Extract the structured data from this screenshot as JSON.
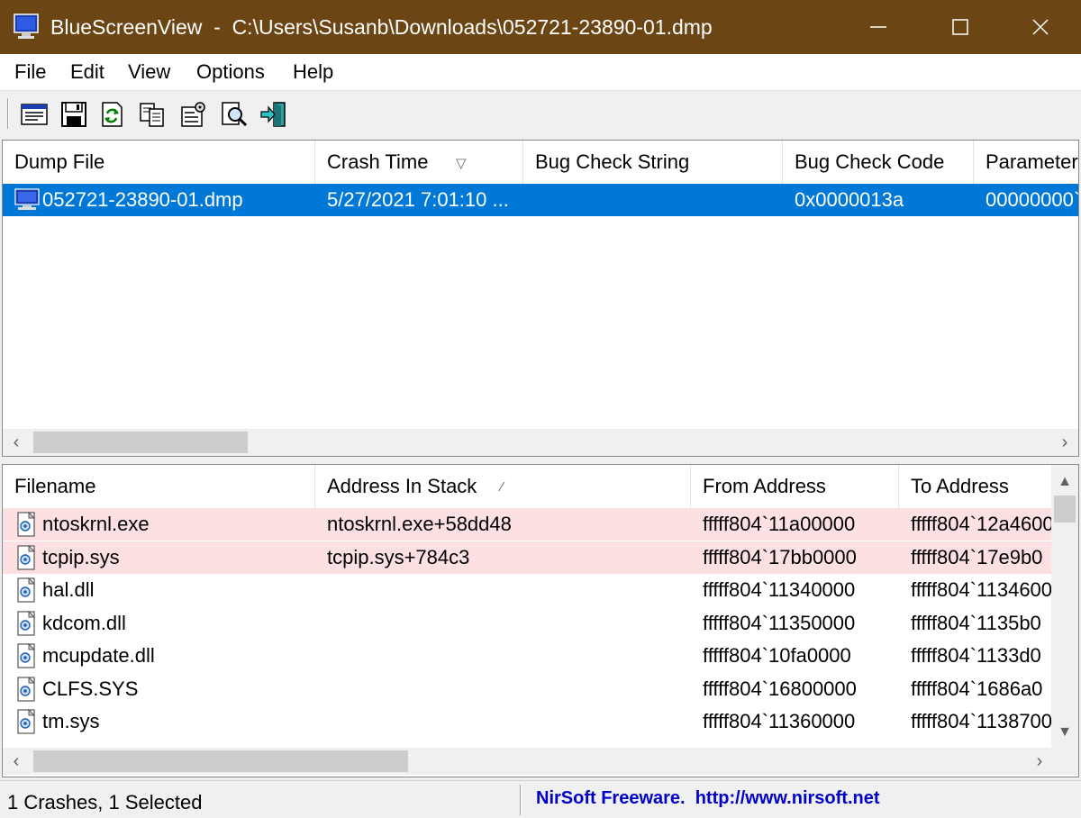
{
  "window": {
    "title": "BlueScreenView  -  C:\\Users\\Susanb\\Downloads\\052721-23890-01.dmp"
  },
  "menu": [
    "File",
    "Edit",
    "View",
    "Options",
    "Help"
  ],
  "toolbar_icons": [
    "properties-icon",
    "save-icon",
    "refresh-icon",
    "copy-icon",
    "advanced-options-icon",
    "find-icon",
    "exit-icon"
  ],
  "crash_list": {
    "columns": [
      "Dump File",
      "Crash Time",
      "Bug Check String",
      "Bug Check Code",
      "Parameter"
    ],
    "sorted_column": "Crash Time",
    "rows": [
      {
        "dump_file": "052721-23890-01.dmp",
        "crash_time": "5/27/2021 7:01:10 ...",
        "bug_check_string": "",
        "bug_check_code": "0x0000013a",
        "parameter": "00000000`0",
        "selected": true
      }
    ]
  },
  "driver_list": {
    "columns": [
      "Filename",
      "Address In Stack",
      "From Address",
      "To Address"
    ],
    "sorted_column": "Address In Stack",
    "rows": [
      {
        "filename": "ntoskrnl.exe",
        "address_in_stack": "ntoskrnl.exe+58dd48",
        "from_address": "fffff804`11a00000",
        "to_address": "fffff804`12a4600",
        "highlight": true
      },
      {
        "filename": "tcpip.sys",
        "address_in_stack": "tcpip.sys+784c3",
        "from_address": "fffff804`17bb0000",
        "to_address": "fffff804`17e9b0",
        "highlight": true
      },
      {
        "filename": "hal.dll",
        "address_in_stack": "",
        "from_address": "fffff804`11340000",
        "to_address": "fffff804`1134600",
        "highlight": false
      },
      {
        "filename": "kdcom.dll",
        "address_in_stack": "",
        "from_address": "fffff804`11350000",
        "to_address": "fffff804`1135b0",
        "highlight": false
      },
      {
        "filename": "mcupdate.dll",
        "address_in_stack": "",
        "from_address": "fffff804`10fa0000",
        "to_address": "fffff804`1133d0",
        "highlight": false
      },
      {
        "filename": "CLFS.SYS",
        "address_in_stack": "",
        "from_address": "fffff804`16800000",
        "to_address": "fffff804`1686a0",
        "highlight": false
      },
      {
        "filename": "tm.sys",
        "address_in_stack": "",
        "from_address": "fffff804`11360000",
        "to_address": "fffff804`1138700",
        "highlight": false
      }
    ]
  },
  "status": {
    "left": "1 Crashes, 1 Selected",
    "right": "NirSoft Freeware.  http://www.nirsoft.net"
  },
  "colors": {
    "titlebar": "#6b4513",
    "selection": "#0078d7",
    "highlight_row": "#fde0e2",
    "status_link": "#0000c8"
  }
}
